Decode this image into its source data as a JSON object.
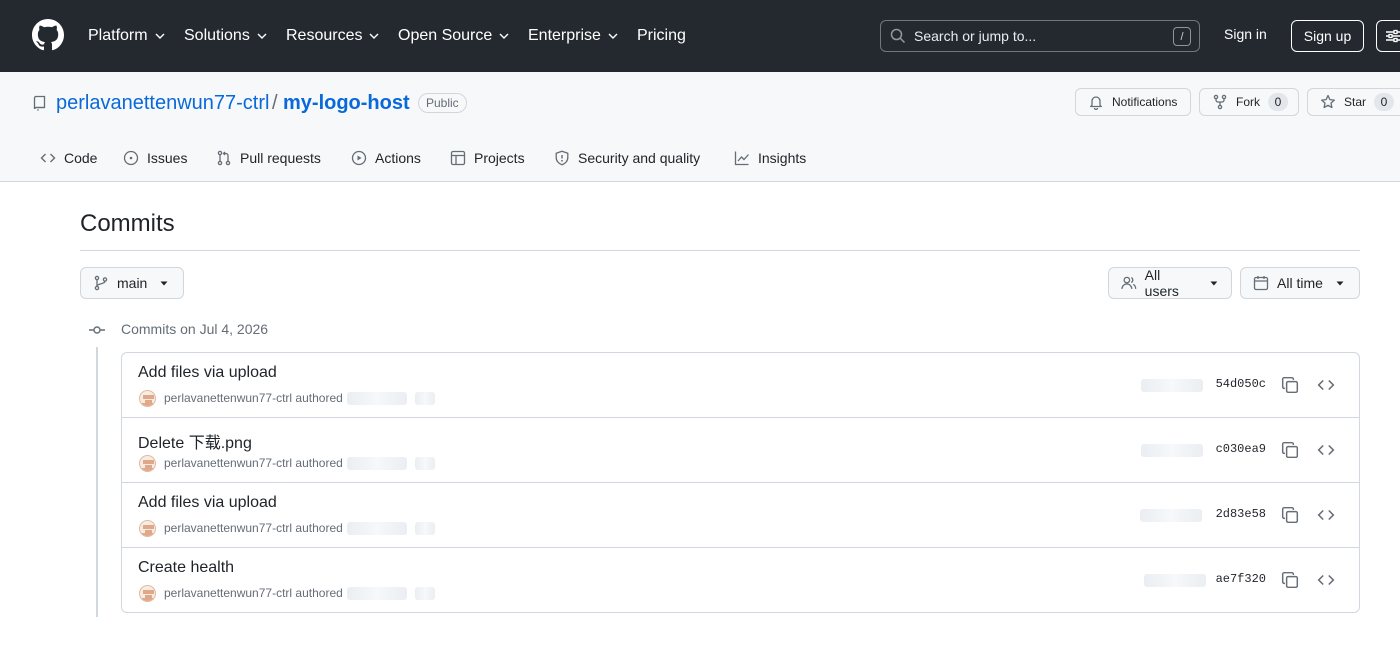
{
  "header": {
    "nav": [
      {
        "label": "Platform",
        "has_menu": true
      },
      {
        "label": "Solutions",
        "has_menu": true
      },
      {
        "label": "Resources",
        "has_menu": true
      },
      {
        "label": "Open Source",
        "has_menu": true
      },
      {
        "label": "Enterprise",
        "has_menu": true
      },
      {
        "label": "Pricing",
        "has_menu": false
      }
    ],
    "search_placeholder": "Search or jump to...",
    "search_shortcut": "/",
    "sign_in": "Sign in",
    "sign_up": "Sign up"
  },
  "repo": {
    "owner": "perlavanettenwun77-ctrl",
    "separator": "/",
    "name": "my-logo-host",
    "visibility": "Public",
    "notifications_label": "Notifications",
    "fork_label": "Fork",
    "fork_count": "0",
    "star_label": "Star",
    "star_count": "0"
  },
  "tabs": [
    {
      "label": "Code",
      "icon": "code-icon"
    },
    {
      "label": "Issues",
      "icon": "issue-opened-icon"
    },
    {
      "label": "Pull requests",
      "icon": "git-pull-request-icon"
    },
    {
      "label": "Actions",
      "icon": "play-icon"
    },
    {
      "label": "Projects",
      "icon": "table-icon"
    },
    {
      "label": "Security and quality",
      "icon": "shield-icon"
    },
    {
      "label": "Insights",
      "icon": "graph-icon"
    }
  ],
  "commits_page": {
    "title": "Commits",
    "branch": "main",
    "users_filter": "All users",
    "time_filter": "All time",
    "group_label": "Commits on Jul 4, 2026",
    "commits": [
      {
        "message": "Add files via upload",
        "author": "perlavanettenwun77-ctrl",
        "verb": "authored",
        "sha": "54d050c"
      },
      {
        "message": "Delete 下载.png",
        "author": "perlavanettenwun77-ctrl",
        "verb": "authored",
        "sha": "c030ea9"
      },
      {
        "message": "Add files via upload",
        "author": "perlavanettenwun77-ctrl",
        "verb": "authored",
        "sha": "2d83e58"
      },
      {
        "message": "Create health",
        "author": "perlavanettenwun77-ctrl",
        "verb": "authored",
        "sha": "ae7f320"
      }
    ]
  },
  "colors": {
    "header_bg": "#24292f",
    "link": "#0969da",
    "border": "#d0d7de",
    "muted": "#656d76"
  }
}
